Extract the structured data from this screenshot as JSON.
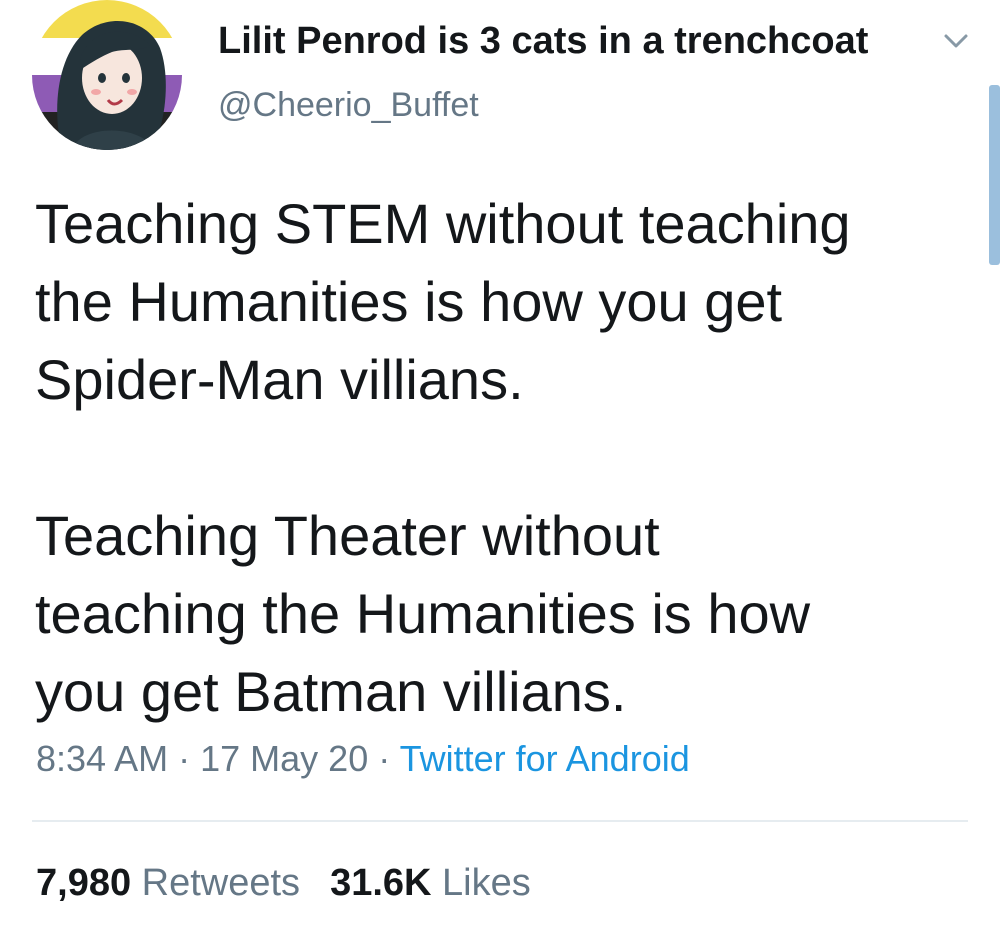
{
  "colors": {
    "name": "#14171a",
    "secondary": "#657786",
    "link": "#1b95e0",
    "divider": "#e6ecf0"
  },
  "user": {
    "display_name": "Lilit Penrod is 3 cats in a trenchcoat",
    "handle": "@Cheerio_Buffet",
    "avatar_icon": "avatar-illustration",
    "menu_icon": "chevron-down-icon"
  },
  "tweet": {
    "paragraphs": [
      "Teaching STEM without teaching\nthe Humanities is how you get\nSpider-Man villians.",
      "Teaching Theater without\nteaching the Humanities is how\nyou get Batman villians."
    ],
    "time": "8:34 AM",
    "date": "17 May 20",
    "separator": "·",
    "source": "Twitter for Android"
  },
  "stats": {
    "retweets_count": "7,980",
    "retweets_label": "Retweets",
    "likes_count": "31.6K",
    "likes_label": "Likes"
  }
}
